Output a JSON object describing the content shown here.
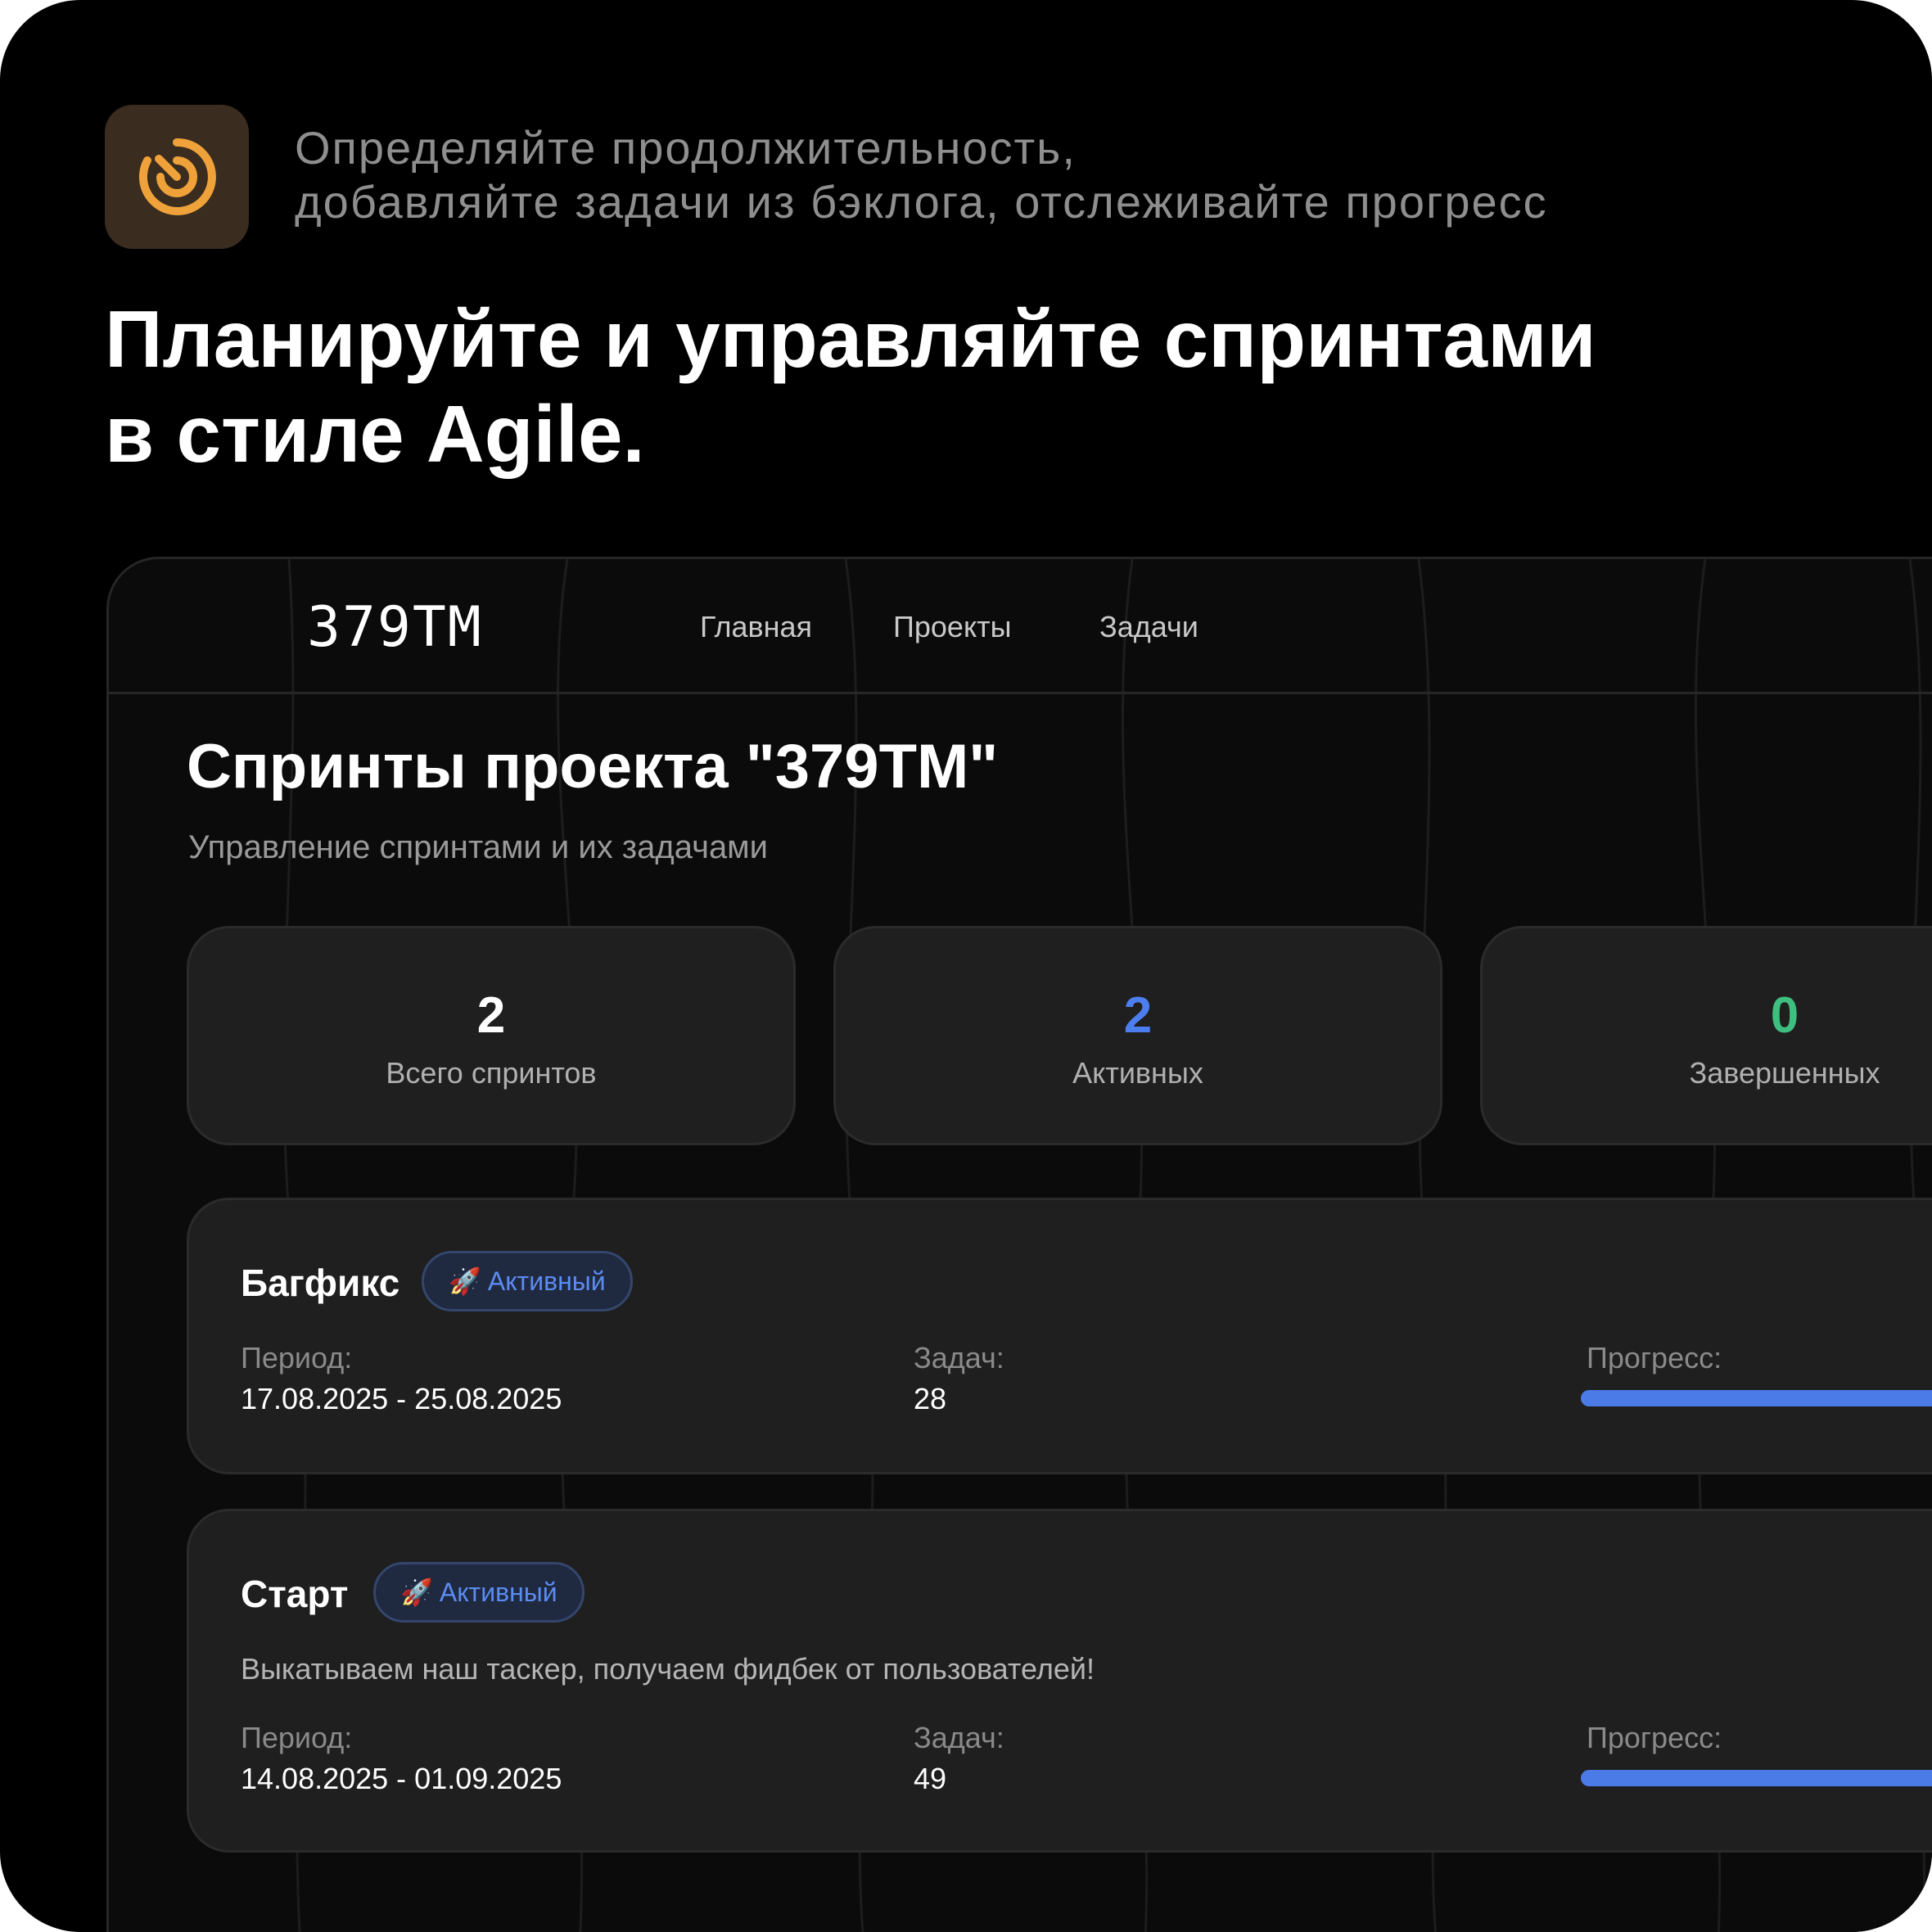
{
  "header": {
    "app_icon": "target-icon",
    "intro_lines": [
      "Определяйте продолжительность,",
      "добавляйте задачи из бэклога, отслеживайте прогресс"
    ],
    "headline_lines": [
      "Планируйте и управляйте спринтами",
      "в стиле Agile."
    ]
  },
  "app": {
    "logo": "379TM",
    "nav": [
      "Главная",
      "Проекты",
      "Задачи"
    ],
    "page_title": "Спринты проекта \"379TM\"",
    "page_subtitle": "Управление спринтами и их задачами",
    "stats": [
      {
        "value": "2",
        "label": "Всего спринтов",
        "color": "#ffffff"
      },
      {
        "value": "2",
        "label": "Активных",
        "color": "#4d7ef0"
      },
      {
        "value": "0",
        "label": "Завершенных",
        "color": "#3fbf7f"
      }
    ],
    "sprints": [
      {
        "name": "Багфикс",
        "status_icon": "rocket-icon",
        "status": "Активный",
        "period_label": "Период:",
        "period": "17.08.2025 - 25.08.2025",
        "tasks_label": "Задач:",
        "tasks": "28",
        "progress_label": "Прогресс:"
      },
      {
        "name": "Старт",
        "status_icon": "rocket-icon",
        "status": "Активный",
        "description": "Выкатываем наш таскер, получаем фидбек от пользователей!",
        "period_label": "Период:",
        "period": "14.08.2025 - 01.09.2025",
        "tasks_label": "Задач:",
        "tasks": "49",
        "progress_label": "Прогресс:"
      }
    ]
  },
  "colors": {
    "accent": "#4d7ef0",
    "success": "#3fbf7f",
    "icon_orange": "#f0a23a"
  }
}
